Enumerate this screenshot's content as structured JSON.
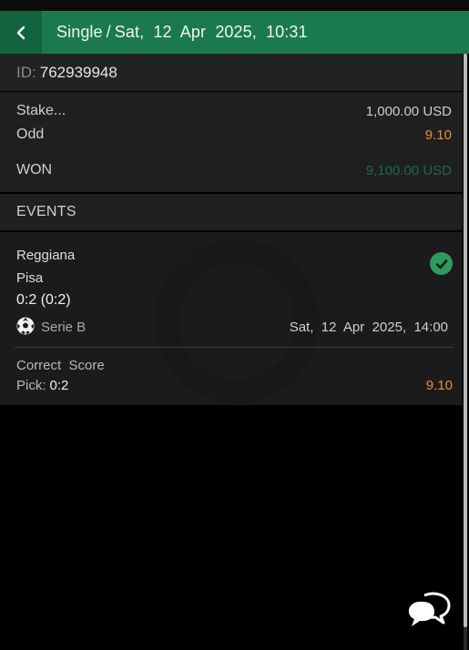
{
  "header": {
    "back_icon": "chevron-left-icon",
    "bet_type": "Single",
    "separator": "/",
    "datetime": "Sat,  12  Apr  2025,  10:31"
  },
  "ticket": {
    "id_label": "ID:",
    "id_value": "762939948"
  },
  "summary": {
    "stake_label": "Stake...",
    "stake_value": "1,000.00 USD",
    "odd_label": "Odd",
    "odd_value": "9.10",
    "status_label": "WON",
    "payout_value": "9,100.00 USD"
  },
  "events_header": "EVENTS",
  "event": {
    "home_team": "Reggiana",
    "away_team": "Pisa",
    "score": "0:2 (0:2)",
    "status_icon": "check-circle-icon",
    "sport_icon": "soccer-ball-icon",
    "league": "Serie B",
    "start_datetime": "Sat,  12  Apr  2025,  14:00",
    "market": "Correct  Score",
    "pick_label": "Pick:",
    "pick_value": "0:2",
    "pick_odd": "9.10"
  },
  "chat": {
    "icon": "chat-bubbles-icon"
  },
  "colors": {
    "header_green": "#1b7a4d",
    "back_green": "#11643d",
    "odd_orange": "#e0913a",
    "won_green": "#1c6a45",
    "check_green": "#2f9a5f"
  }
}
